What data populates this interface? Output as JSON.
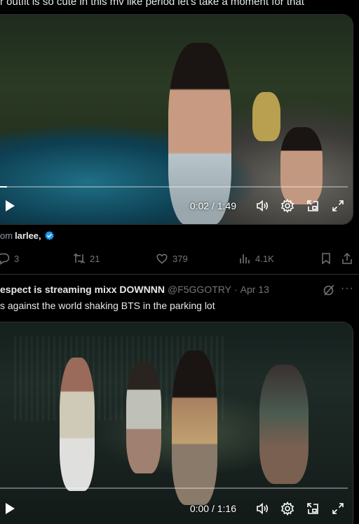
{
  "top_text": "r outfit is so cute in this mv like period let's take a moment for that",
  "video1": {
    "time": "0:02 / 1:49",
    "progress_fraction": 0.02
  },
  "attribution": {
    "prefix": "om",
    "name": "larlee,"
  },
  "actions": {
    "replies": "3",
    "reposts": "21",
    "likes": "379",
    "views": "4.1K"
  },
  "tweet": {
    "display_name": "espect is streaming mixx DOWNNN",
    "handle": "@F5GGOTRY",
    "dot": "·",
    "date": "Apr 13",
    "more": "···",
    "text": "s against the world shaking BTS in the parking lot"
  },
  "video2": {
    "time": "0:00 / 1:16",
    "progress_fraction": 0.0
  },
  "colors": {
    "background": "#000000",
    "muted_text": "#71767b",
    "verified_blue": "#1d9bf0",
    "divider": "#2f3336"
  }
}
